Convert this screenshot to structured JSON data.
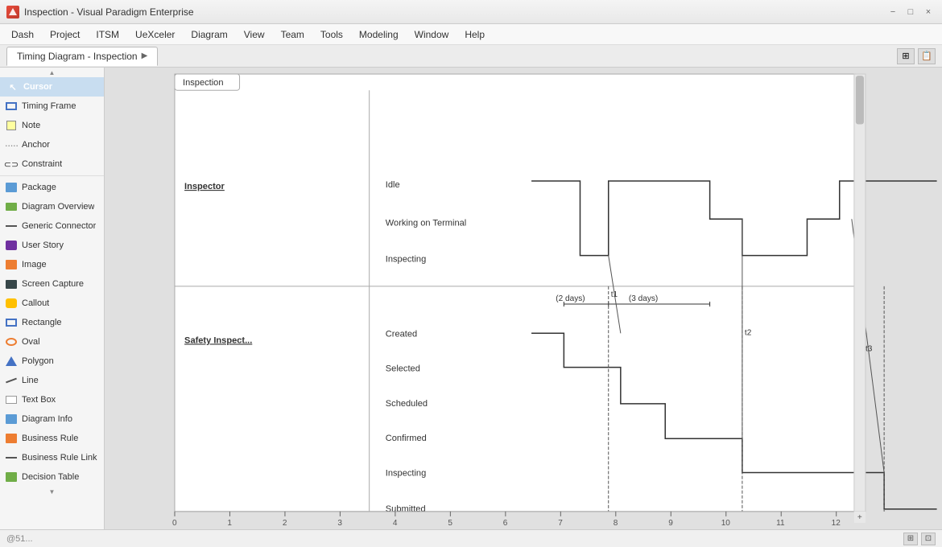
{
  "app": {
    "title": "Inspection - Visual Paradigm Enterprise",
    "icon": "vp-icon"
  },
  "window_controls": {
    "minimize": "−",
    "maximize": "□",
    "close": "×"
  },
  "menu": {
    "items": [
      "Dash",
      "Project",
      "ITSM",
      "UeXceler",
      "Diagram",
      "View",
      "Team",
      "Tools",
      "Modeling",
      "Window",
      "Help"
    ]
  },
  "tab": {
    "label": "Timing Diagram - Inspection",
    "arrow": "▶"
  },
  "toolbar_icons": {
    "icon1": "⊞",
    "icon2": "📋"
  },
  "left_panel": {
    "cursor_label": "Cursor",
    "items": [
      {
        "id": "timing-frame",
        "label": "Timing Frame",
        "icon": "frame"
      },
      {
        "id": "note",
        "label": "Note",
        "icon": "note"
      },
      {
        "id": "anchor",
        "label": "Anchor",
        "icon": "anchor"
      },
      {
        "id": "constraint",
        "label": "Constraint",
        "icon": "constraint"
      },
      {
        "id": "package",
        "label": "Package",
        "icon": "package"
      },
      {
        "id": "diagram-overview",
        "label": "Diagram Overview",
        "icon": "overview"
      },
      {
        "id": "generic-connector",
        "label": "Generic Connector",
        "icon": "connector"
      },
      {
        "id": "user-story",
        "label": "User Story",
        "icon": "story"
      },
      {
        "id": "image",
        "label": "Image",
        "icon": "image"
      },
      {
        "id": "screen-capture",
        "label": "Screen Capture",
        "icon": "screen"
      },
      {
        "id": "callout",
        "label": "Callout",
        "icon": "callout"
      },
      {
        "id": "rectangle",
        "label": "Rectangle",
        "icon": "rect"
      },
      {
        "id": "oval",
        "label": "Oval",
        "icon": "oval"
      },
      {
        "id": "polygon",
        "label": "Polygon",
        "icon": "poly"
      },
      {
        "id": "line",
        "label": "Line",
        "icon": "line"
      },
      {
        "id": "text-box",
        "label": "Text Box",
        "icon": "textbox"
      },
      {
        "id": "diagram-info",
        "label": "Diagram Info",
        "icon": "diaginfo"
      },
      {
        "id": "business-rule",
        "label": "Business Rule",
        "icon": "business"
      },
      {
        "id": "business-rule-link",
        "label": "Business Rule Link",
        "icon": "bizlink"
      },
      {
        "id": "decision-table",
        "label": "Decision Table",
        "icon": "decision"
      }
    ],
    "expand_top": "▲",
    "expand_bottom": "▼"
  },
  "diagram": {
    "tab_label": "Inspection",
    "inspector_label": "Inspector",
    "safety_label": "Safety Inspect...",
    "inspector_states": [
      "Idle",
      "Working on Terminal",
      "Inspecting"
    ],
    "safety_states": [
      "Created",
      "Selected",
      "Scheduled",
      "Confirmed",
      "Inspecting",
      "Submitted"
    ],
    "duration_labels": [
      "(2 days)",
      "(3 days)"
    ],
    "duration_markers": [
      "t1",
      "t2",
      "t3"
    ],
    "x_axis_labels": [
      "0",
      "1",
      "2",
      "3",
      "4",
      "5",
      "6",
      "7",
      "8",
      "9",
      "10",
      "11",
      "12"
    ],
    "title": "Inspection"
  },
  "status_bar": {
    "watermark": "@51...",
    "zoom_icon": "⊞",
    "fit_icon": "⊡"
  }
}
